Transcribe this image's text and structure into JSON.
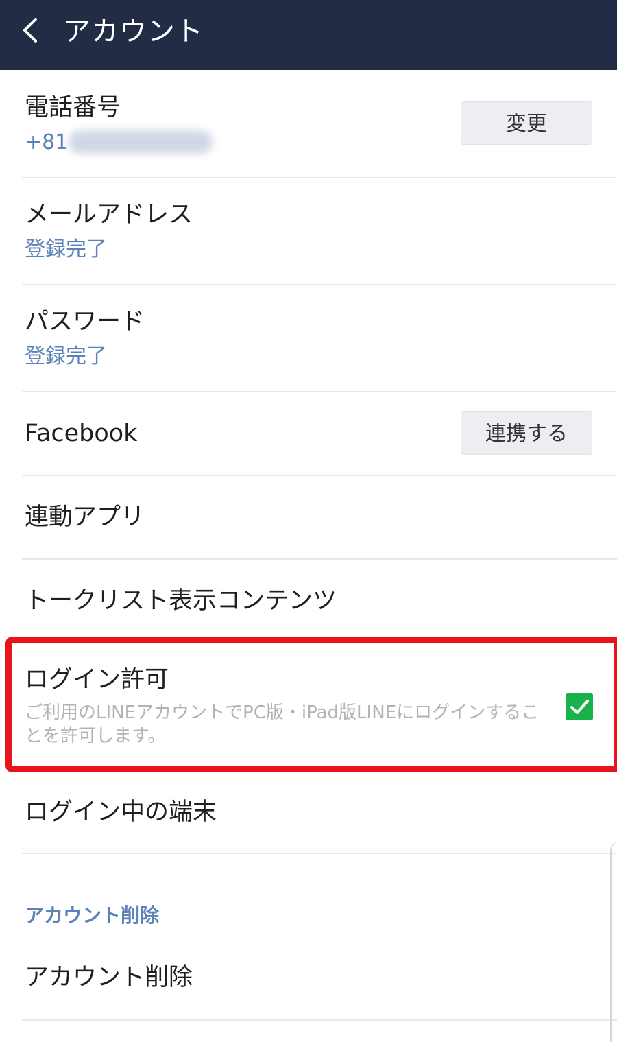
{
  "header": {
    "title": "アカウント"
  },
  "phone": {
    "label": "電話番号",
    "value": "+81",
    "button": "変更"
  },
  "email": {
    "label": "メールアドレス",
    "status": "登録完了"
  },
  "password": {
    "label": "パスワード",
    "status": "登録完了"
  },
  "facebook": {
    "label": "Facebook",
    "button": "連携する"
  },
  "linked_apps": {
    "label": "連動アプリ"
  },
  "talk_list": {
    "label": "トークリスト表示コンテンツ"
  },
  "login_permission": {
    "label": "ログイン許可",
    "description": "ご利用のLINEアカウントでPC版・iPad版LINEにログインすることを許可します。",
    "checked": true
  },
  "logged_in_devices": {
    "label": "ログイン中の端末"
  },
  "delete_section": {
    "header": "アカウント削除",
    "item": "アカウント削除"
  },
  "colors": {
    "header_bg": "#232c45",
    "accent_blue": "#5b83b8",
    "check_green": "#17b24a",
    "highlight_red": "#e8141b"
  }
}
